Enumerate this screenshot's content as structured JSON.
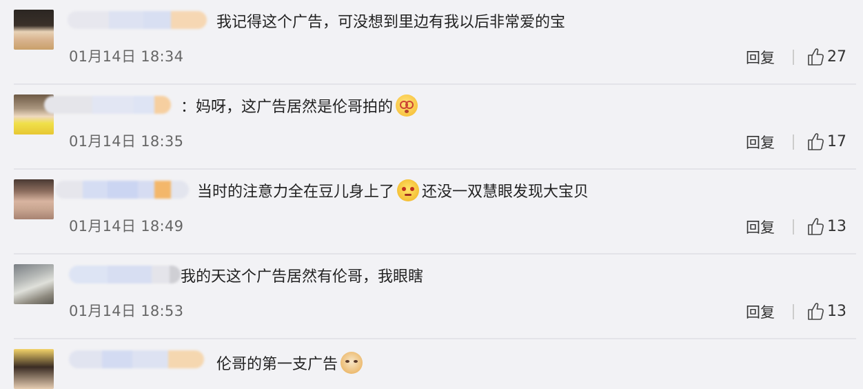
{
  "comments": [
    {
      "username": "",
      "text": "我记得这个广告，可没想到里边有我以后非常爱的宝",
      "emoji": "",
      "text_after": "",
      "time": "01月14日 18:34",
      "reply_label": "回复",
      "likes": "27"
    },
    {
      "username": "",
      "text": "：妈呀，这广告居然是伦哥拍的",
      "emoji": "dizzy-face-emoji",
      "text_after": "",
      "time": "01月14日 18:35",
      "reply_label": "回复",
      "likes": "17"
    },
    {
      "username": "",
      "text": "当时的注意力全在豆儿身上了",
      "emoji": "angry-cat-emoji",
      "text_after": "还没一双慧眼发现大宝贝",
      "time": "01月14日 18:49",
      "reply_label": "回复",
      "likes": "13"
    },
    {
      "username": "",
      "text": "我的天这个广告居然有伦哥，我眼瞎",
      "emoji": "",
      "text_after": "",
      "time": "01月14日 18:53",
      "reply_label": "回复",
      "likes": "13"
    },
    {
      "username": "",
      "text": "伦哥的第一支广告",
      "emoji": "cat-face-emoji",
      "text_after": "",
      "time": "",
      "reply_label": "",
      "likes": ""
    }
  ],
  "colors": {
    "background": "#f2f2f5",
    "time_text": "#666666",
    "separator": "#e3e3e8"
  }
}
